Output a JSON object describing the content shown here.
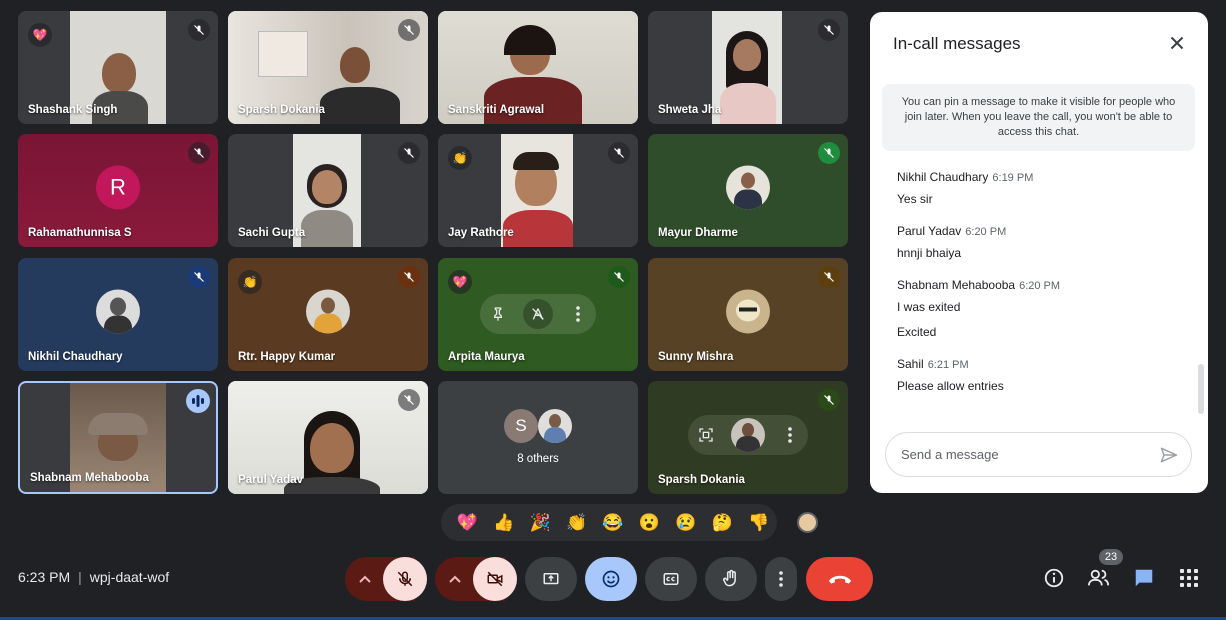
{
  "participants": [
    {
      "name": "Shashank Singh",
      "badge": "💖"
    },
    {
      "name": "Sparsh Dokania"
    },
    {
      "name": "Sanskriti Agrawal"
    },
    {
      "name": "Shweta Jha"
    },
    {
      "name": "Rahamathunnisa S",
      "initial": "R"
    },
    {
      "name": "Sachi Gupta"
    },
    {
      "name": "Jay Rathore",
      "badge": "👏"
    },
    {
      "name": "Mayur Dharme"
    },
    {
      "name": "Nikhil Chaudhary"
    },
    {
      "name": "Rtr. Happy Kumar",
      "badge": "👏"
    },
    {
      "name": "Arpita Maurya",
      "badge": "💖"
    },
    {
      "name": "Sunny Mishra"
    },
    {
      "name": "Shabnam Mehabooba"
    },
    {
      "name": "Parul Yadav"
    },
    {
      "name": "8 others",
      "initial": "S"
    },
    {
      "name": "Sparsh Dokania"
    }
  ],
  "chat": {
    "title": "In-call messages",
    "info": "You can pin a message to make it visible for people who join later. When you leave the call, you won't be able to access this chat.",
    "messages": [
      {
        "sender": "Nikhil Chaudhary",
        "time": "6:19 PM",
        "lines": [
          "Yes sir"
        ]
      },
      {
        "sender": "Parul Yadav",
        "time": "6:20 PM",
        "lines": [
          "hnnji bhaiya"
        ]
      },
      {
        "sender": "Shabnam Mehabooba",
        "time": "6:20 PM",
        "lines": [
          "I was exited",
          "Excited"
        ]
      },
      {
        "sender": "Sahil",
        "time": "6:21 PM",
        "lines": [
          "Please allow entries"
        ]
      }
    ],
    "input_placeholder": "Send a message"
  },
  "reactions": [
    "💖",
    "👍",
    "🎉",
    "👏",
    "😂",
    "😮",
    "😢",
    "🤔",
    "👎"
  ],
  "meeting": {
    "time": "6:23 PM",
    "code": "wpj-daat-wof"
  },
  "people_count": "23",
  "colors": {
    "end_call": "#ea4335",
    "muted_bg": "#f9dedc",
    "active": "#a8c7fa",
    "panel": "#ffffff",
    "dark_ctrl": "#3c4043"
  }
}
